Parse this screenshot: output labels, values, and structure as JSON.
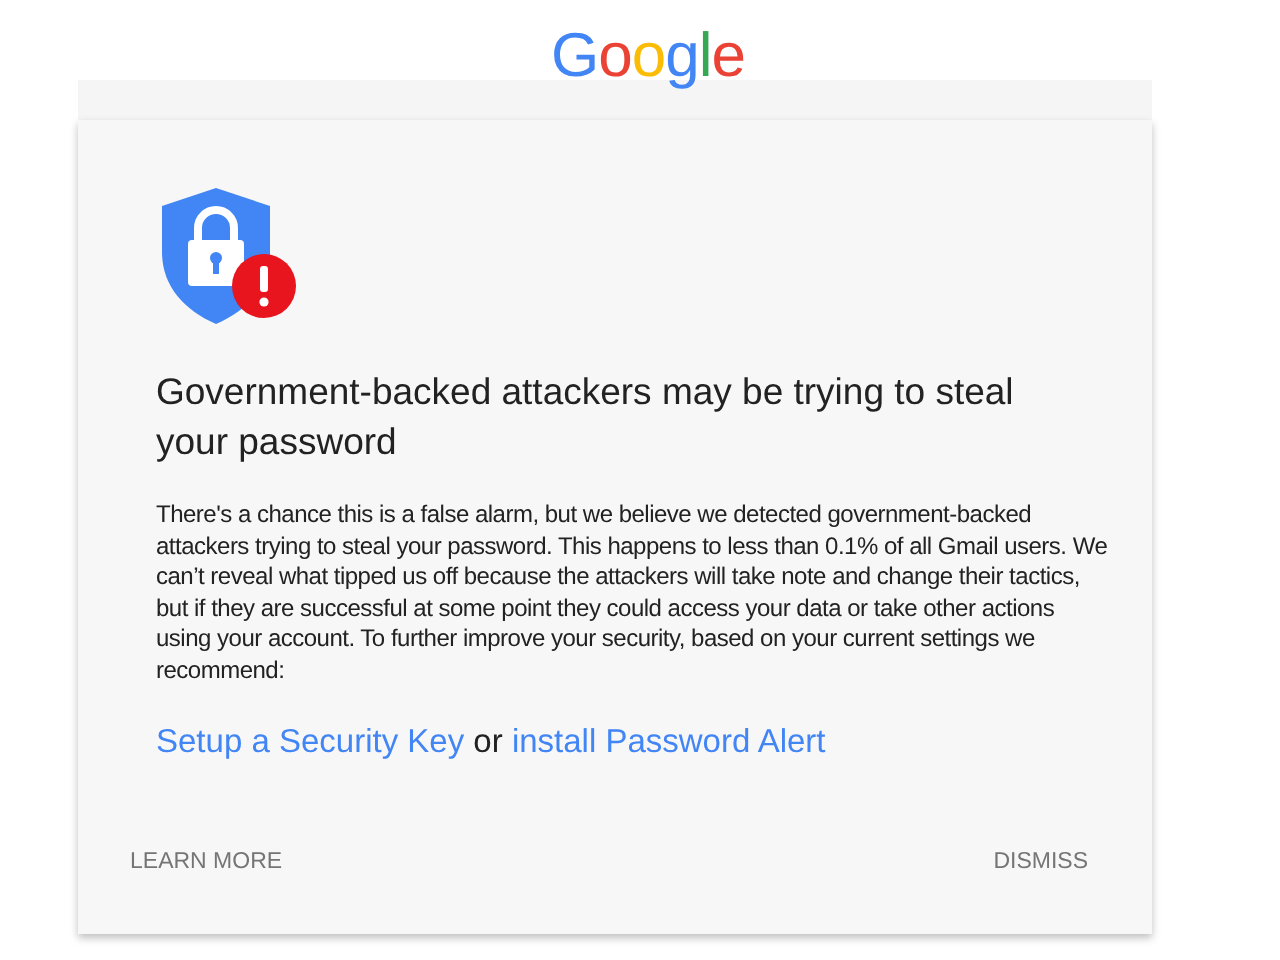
{
  "logo": "Google",
  "alert": {
    "title": "Government-backed attackers may be trying to steal your password",
    "body": "There's a chance this is a false alarm, but we believe we detected government-backed attackers trying to steal your password. This happens to less than 0.1% of all Gmail users. We can’t reveal what tipped us off because the attackers will take note and change their tactics, but if they are successful at some point they could access your data or take other actions using your account. To further improve your security, based on your current settings we recommend:",
    "recommendation": [
      {
        "kind": "link",
        "text": "Setup a Security Key"
      },
      {
        "kind": "text",
        "text": "or"
      },
      {
        "kind": "link",
        "text": "install Password Alert"
      }
    ],
    "buttons": [
      "LEARN MORE",
      "DISMISS"
    ]
  }
}
